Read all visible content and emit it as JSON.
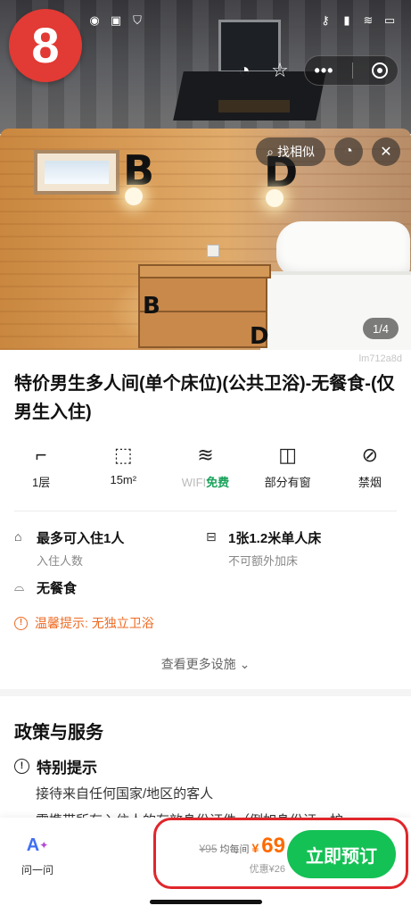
{
  "step_badge": "8",
  "status_bar": {
    "left_icons": [
      "line-icon",
      "message-icon",
      "shield-icon"
    ],
    "right_icons": [
      "key-icon",
      "signal-icon",
      "wifi-icon",
      "battery-icon"
    ]
  },
  "top_actions": {
    "icons": [
      "history-icon",
      "star-icon",
      "more-icon",
      "target-icon"
    ]
  },
  "photo": {
    "find_similar": "找相似",
    "page_indicator": "1/4",
    "watermark": "lm712a8d"
  },
  "room": {
    "title": "特价男生多人间(单个床位)(公共卫浴)-无餐食-(仅男生入住)"
  },
  "amenities": [
    {
      "icon": "stairs-icon",
      "label": "1层"
    },
    {
      "icon": "area-icon",
      "label": "15m²"
    },
    {
      "icon": "wifi-icon",
      "label_gray": "WIFI",
      "label_green": "免费"
    },
    {
      "icon": "window-icon",
      "label": "部分有窗"
    },
    {
      "icon": "no-smoking-icon",
      "label": "禁烟"
    }
  ],
  "info": {
    "occupancy_main": "最多可入住1人",
    "occupancy_sub": "入住人数",
    "bed_main": "1张1.2米单人床",
    "bed_sub": "不可额外加床",
    "meal": "无餐食",
    "tip": "温馨提示: 无独立卫浴",
    "more_facilities": "查看更多设施"
  },
  "policy": {
    "title": "政策与服务",
    "special_title": "特别提示",
    "line1": "接待来自任何国家/地区的客人",
    "line2": "需携带所有入住人的有效身份证件（例如身份证、护"
  },
  "bottom": {
    "ask_label": "问一问",
    "original_price": "¥95",
    "per_night": "均每间",
    "currency": "¥",
    "price": "69",
    "discount": "优惠¥26",
    "book_label": "立即预订"
  },
  "colors": {
    "accent_red": "#e23a34",
    "price_orange": "#ff6a00",
    "book_green": "#14c154",
    "tip_orange": "#ee6a22",
    "wifi_green": "#19a35b"
  }
}
